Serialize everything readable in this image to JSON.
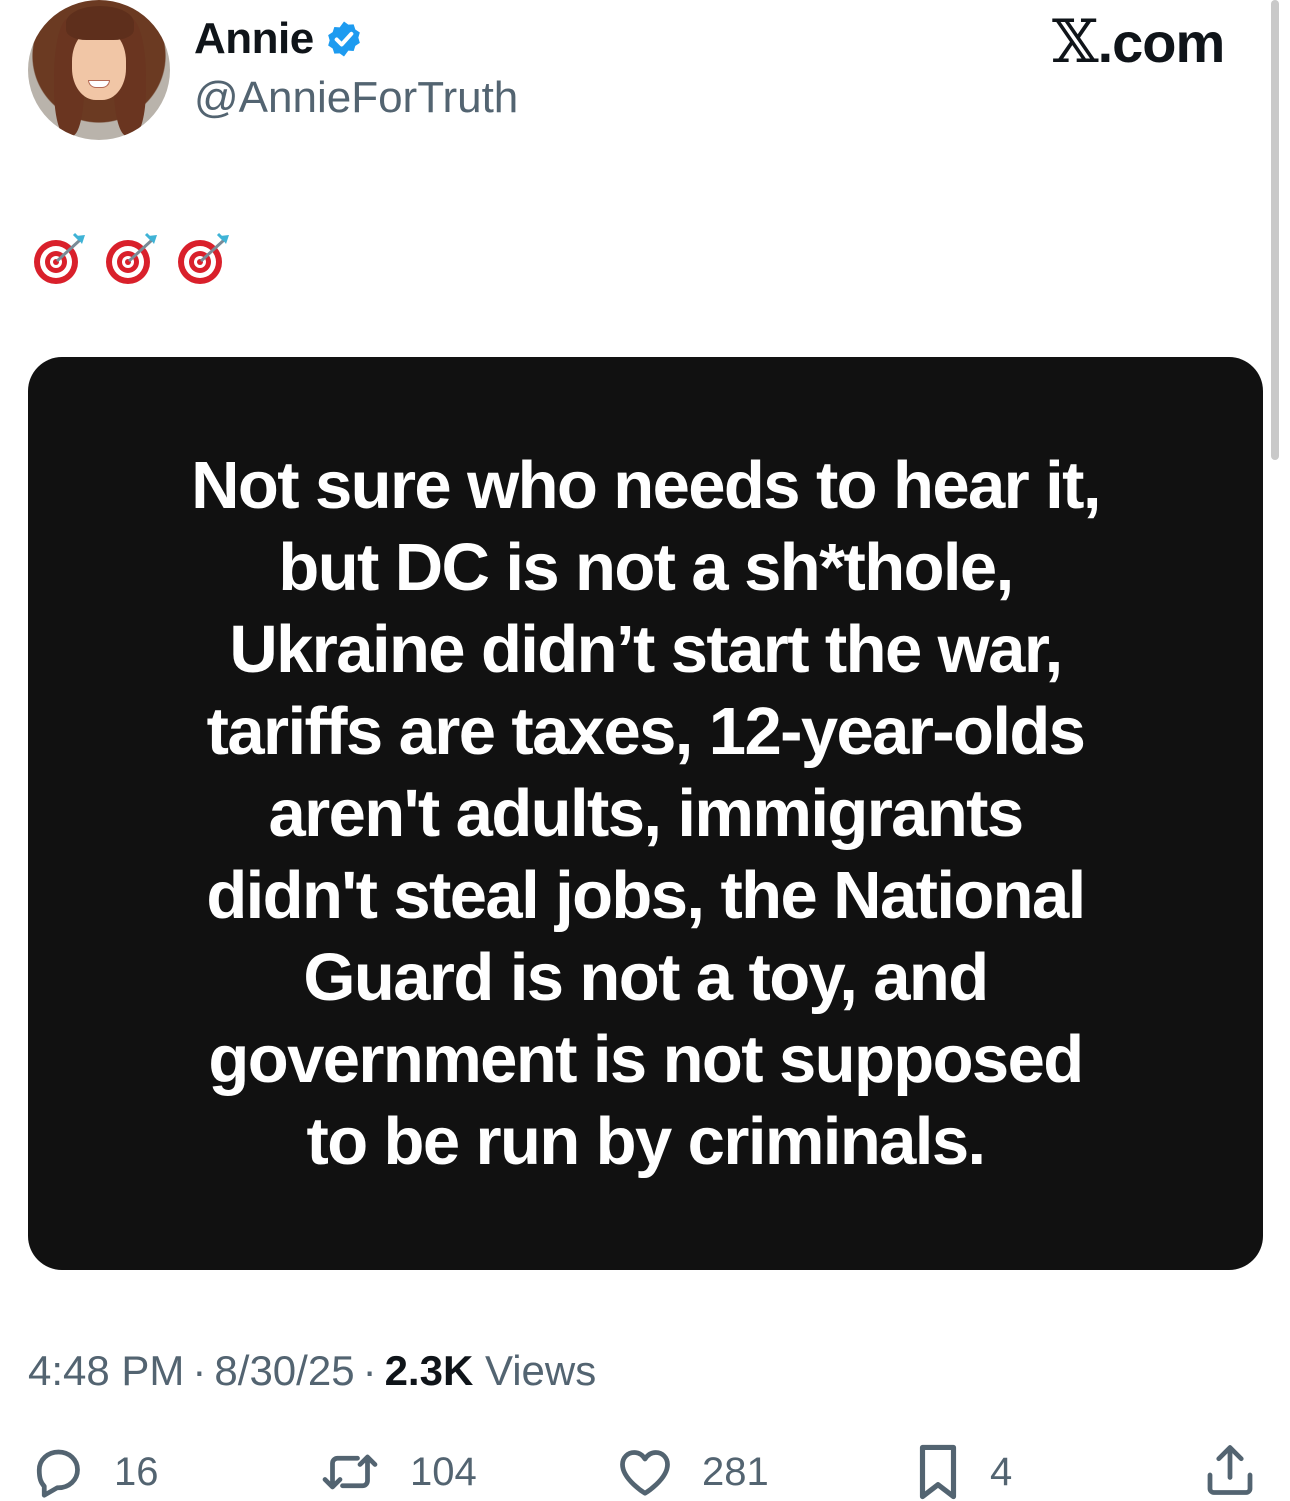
{
  "author": {
    "display_name": "Annie",
    "handle": "@AnnieForTruth",
    "verified": true,
    "verified_color": "#1d9bf0"
  },
  "brand": {
    "logo_text": "𝕏",
    "domain_suffix": ".com"
  },
  "post": {
    "emoji": [
      "target-dart-icon",
      "target-dart-icon",
      "target-dart-icon"
    ],
    "image_text": "Not sure who needs to hear it,\nbut DC is not a sh*thole,\nUkraine didn’t start the war,\ntariffs are taxes, 12-year-olds\naren't adults, immigrants\ndidn't steal jobs, the National\nGuard is not a toy, and\ngovernment is not supposed\nto be run by criminals.",
    "time": "4:48 PM",
    "date": "8/30/25",
    "views_count": "2.3K",
    "views_label": "Views",
    "separator": "·"
  },
  "actions": {
    "replies": "16",
    "reposts": "104",
    "likes": "281",
    "bookmarks": "4"
  },
  "colors": {
    "card_background": "#111111",
    "muted_text": "#536471",
    "primary_text": "#0f1419"
  }
}
